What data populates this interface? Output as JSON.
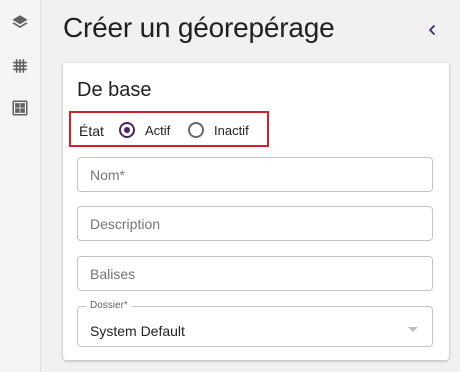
{
  "sidebar": {
    "icons": [
      "layers-icon",
      "grid-icon",
      "dashboard-icon"
    ]
  },
  "header": {
    "title": "Créer un géorepérage"
  },
  "form": {
    "section_title": "De base",
    "status": {
      "label": "État",
      "options": [
        {
          "label": "Actif",
          "checked": true
        },
        {
          "label": "Inactif",
          "checked": false
        }
      ]
    },
    "name": {
      "placeholder": "Nom*",
      "value": ""
    },
    "description": {
      "placeholder": "Description",
      "value": ""
    },
    "tags": {
      "placeholder": "Balises",
      "value": ""
    },
    "folder": {
      "label": "Dossier*",
      "value": "System Default"
    }
  },
  "colors": {
    "accent": "#4a2463",
    "highlight": "#d61f26",
    "background": "#f1f1f1"
  }
}
